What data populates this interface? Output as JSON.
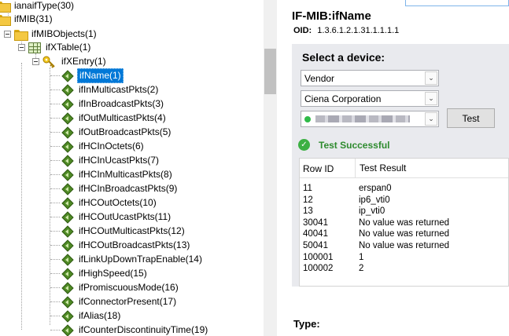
{
  "tree": {
    "nodes": [
      {
        "label": "ianaifType(30)",
        "icon": "folder-icon"
      },
      {
        "label": "ifMIB(31)",
        "icon": "folder-icon"
      },
      {
        "label": "ifMIBObjects(1)",
        "icon": "folder-icon"
      },
      {
        "label": "ifXTable(1)",
        "icon": "table-icon"
      },
      {
        "label": "ifXEntry(1)",
        "icon": "key-icon"
      },
      {
        "label": "ifName(1)",
        "icon": "leaf-icon",
        "selected": true
      },
      {
        "label": "ifInMulticastPkts(2)",
        "icon": "leaf-icon"
      },
      {
        "label": "ifInBroadcastPkts(3)",
        "icon": "leaf-icon"
      },
      {
        "label": "ifOutMulticastPkts(4)",
        "icon": "leaf-icon"
      },
      {
        "label": "ifOutBroadcastPkts(5)",
        "icon": "leaf-icon"
      },
      {
        "label": "ifHCInOctets(6)",
        "icon": "leaf-icon"
      },
      {
        "label": "ifHCInUcastPkts(7)",
        "icon": "leaf-icon"
      },
      {
        "label": "ifHCInMulticastPkts(8)",
        "icon": "leaf-icon"
      },
      {
        "label": "ifHCInBroadcastPkts(9)",
        "icon": "leaf-icon"
      },
      {
        "label": "ifHCOutOctets(10)",
        "icon": "leaf-icon"
      },
      {
        "label": "ifHCOutUcastPkts(11)",
        "icon": "leaf-icon"
      },
      {
        "label": "ifHCOutMulticastPkts(12)",
        "icon": "leaf-icon"
      },
      {
        "label": "ifHCOutBroadcastPkts(13)",
        "icon": "leaf-icon"
      },
      {
        "label": "ifLinkUpDownTrapEnable(14)",
        "icon": "leaf-icon"
      },
      {
        "label": "ifHighSpeed(15)",
        "icon": "leaf-icon"
      },
      {
        "label": "ifPromiscuousMode(16)",
        "icon": "leaf-icon"
      },
      {
        "label": "ifConnectorPresent(17)",
        "icon": "leaf-icon"
      },
      {
        "label": "ifAlias(18)",
        "icon": "leaf-icon"
      },
      {
        "label": "ifCounterDiscontinuityTime(19)",
        "icon": "leaf-icon"
      }
    ]
  },
  "detail": {
    "title": "IF-MIB:ifName",
    "oid_label": "OID:",
    "oid_value": "1.3.6.1.2.1.31.1.1.1.1",
    "select_device_label": "Select a device:",
    "vendor_select": "Vendor",
    "manufacturer_select": "Ciena Corporation",
    "device_select_status_color": "#2fba48",
    "test_button": "Test",
    "status_text": "Test Successful",
    "results": {
      "columns": [
        "Row ID",
        "Test Result"
      ],
      "rows": [
        [
          "11",
          "erspan0"
        ],
        [
          "12",
          "ip6_vti0"
        ],
        [
          "13",
          "ip_vti0"
        ],
        [
          "30041",
          "No value was returned"
        ],
        [
          "40041",
          "No value was returned"
        ],
        [
          "50041",
          "No value was returned"
        ],
        [
          "100001",
          "1"
        ],
        [
          "100002",
          "2"
        ]
      ]
    },
    "type_label": "Type:"
  }
}
